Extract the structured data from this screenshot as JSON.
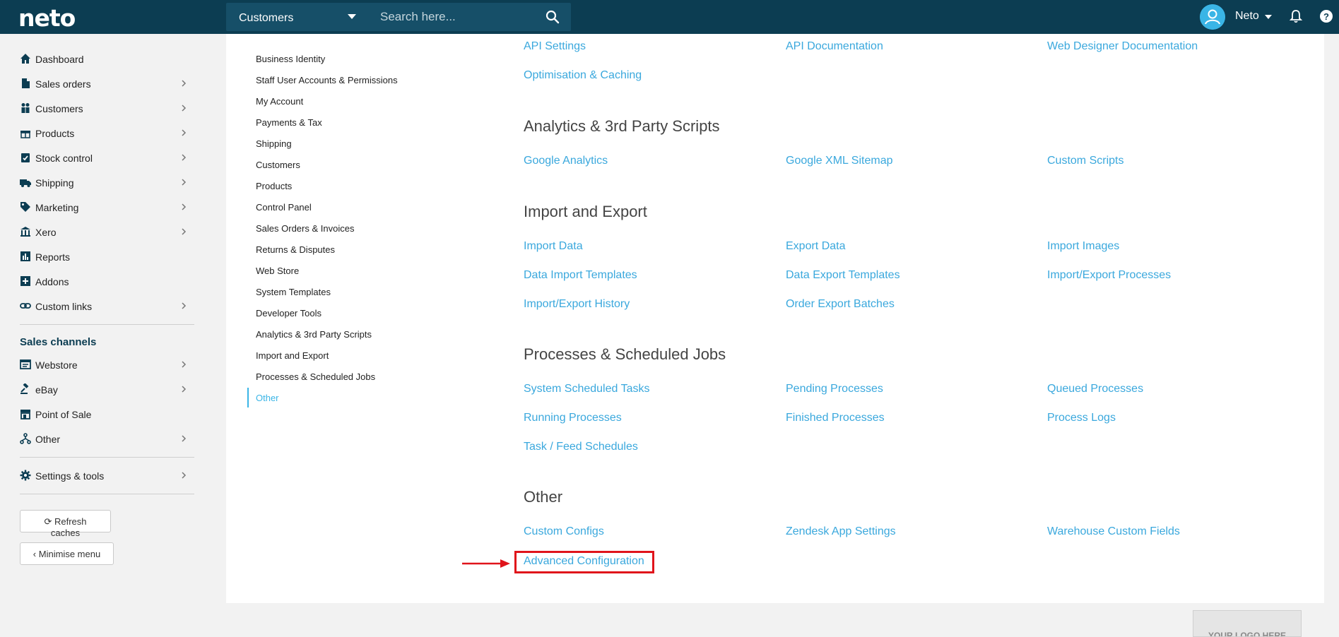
{
  "topbar": {
    "logo": "neto",
    "search_type": "Customers",
    "search_placeholder": "Search here...",
    "user_name": "Neto"
  },
  "sidebar": {
    "items": [
      {
        "label": "Dashboard",
        "icon": "home-icon",
        "chevron": false
      },
      {
        "label": "Sales orders",
        "icon": "document-icon",
        "chevron": true
      },
      {
        "label": "Customers",
        "icon": "users-icon",
        "chevron": true
      },
      {
        "label": "Products",
        "icon": "gift-icon",
        "chevron": true
      },
      {
        "label": "Stock control",
        "icon": "clipboard-check-icon",
        "chevron": true
      },
      {
        "label": "Shipping",
        "icon": "truck-icon",
        "chevron": true
      },
      {
        "label": "Marketing",
        "icon": "tag-icon",
        "chevron": true
      },
      {
        "label": "Xero",
        "icon": "bank-icon",
        "chevron": true
      },
      {
        "label": "Reports",
        "icon": "bar-chart-icon",
        "chevron": false
      },
      {
        "label": "Addons",
        "icon": "plus-square-icon",
        "chevron": false
      },
      {
        "label": "Custom links",
        "icon": "link-icon",
        "chevron": true
      }
    ],
    "channels_heading": "Sales channels",
    "channels": [
      {
        "label": "Webstore",
        "icon": "browser-icon",
        "chevron": true
      },
      {
        "label": "eBay",
        "icon": "gavel-icon",
        "chevron": true
      },
      {
        "label": "Point of Sale",
        "icon": "store-icon",
        "chevron": false
      },
      {
        "label": "Other",
        "icon": "sitemap-icon",
        "chevron": true
      }
    ],
    "settings": {
      "label": "Settings & tools",
      "icon": "gear-icon",
      "chevron": true
    },
    "refresh_label": "Refresh caches",
    "minimise_label": "Minimise menu"
  },
  "subnav": [
    "Business Identity",
    "Staff User Accounts & Permissions",
    "My Account",
    "Payments & Tax",
    "Shipping",
    "Customers",
    "Products",
    "Control Panel",
    "Sales Orders & Invoices",
    "Returns & Disputes",
    "Web Store",
    "System Templates",
    "Developer Tools",
    "Analytics & 3rd Party Scripts",
    "Import and Export",
    "Processes & Scheduled Jobs",
    "Other"
  ],
  "sections": {
    "top_links": [
      [
        "API Settings",
        "API Documentation",
        "Web Designer Documentation"
      ],
      [
        "Optimisation & Caching",
        "",
        ""
      ]
    ],
    "analytics": {
      "title": "Analytics & 3rd Party Scripts",
      "rows": [
        [
          "Google Analytics",
          "Google XML Sitemap",
          "Custom Scripts"
        ]
      ]
    },
    "import_export": {
      "title": "Import and Export",
      "rows": [
        [
          "Import Data",
          "Export Data",
          "Import Images"
        ],
        [
          "Data Import Templates",
          "Data Export Templates",
          "Import/Export Processes"
        ],
        [
          "Import/Export History",
          "Order Export Batches",
          ""
        ]
      ]
    },
    "processes": {
      "title": "Processes & Scheduled Jobs",
      "rows": [
        [
          "System Scheduled Tasks",
          "Pending Processes",
          "Queued Processes"
        ],
        [
          "Running Processes",
          "Finished Processes",
          "Process Logs"
        ],
        [
          "Task / Feed Schedules",
          "",
          ""
        ]
      ]
    },
    "other": {
      "title": "Other",
      "rows": [
        [
          "Custom Configs",
          "Zendesk App Settings",
          "Warehouse Custom Fields"
        ],
        [
          "Advanced Configuration",
          "",
          ""
        ]
      ]
    }
  },
  "footer_logo": "YOUR LOGO HERE",
  "colors": {
    "topbar": "#0c3d52",
    "link": "#3aa8dd",
    "highlight": "#e0141b"
  }
}
